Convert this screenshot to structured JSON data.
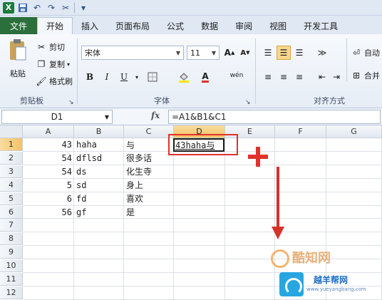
{
  "qat": {
    "icons": [
      "excel-logo",
      "save-icon",
      "undo-icon",
      "redo-icon",
      "customize-icon"
    ]
  },
  "tabs": [
    "文件",
    "开始",
    "插入",
    "页面布局",
    "公式",
    "数据",
    "审阅",
    "视图",
    "开发工具"
  ],
  "active_tab": "开始",
  "clipboard": {
    "paste": "粘贴",
    "cut": "剪切",
    "copy": "复制",
    "format_painter": "格式刷",
    "label": "剪贴板"
  },
  "font": {
    "name": "宋体",
    "size": "11",
    "label": "字体",
    "bold": "B",
    "italic": "I",
    "underline": "U",
    "font_color_glyph": "A",
    "phonetic": "wén"
  },
  "alignment": {
    "label": "对齐方式",
    "wrap": "自动",
    "merge": "合并"
  },
  "formula_bar": {
    "name_box": "D1",
    "fx": "fx",
    "formula": "=A1&B1&C1"
  },
  "columns": [
    "A",
    "B",
    "C",
    "D",
    "E",
    "F",
    "G"
  ],
  "rows": [
    "1",
    "2",
    "3",
    "4",
    "5",
    "6",
    "7",
    "8",
    "9",
    "10",
    "11",
    "12"
  ],
  "cells": {
    "A": [
      "43",
      "54",
      "54",
      "5",
      "6",
      "56"
    ],
    "B": [
      "haha",
      "dflsd",
      "ds",
      "sd",
      "fd",
      "gf"
    ],
    "C": [
      "与",
      "很多话",
      "化生寺",
      "身上",
      "喜欢",
      "是"
    ],
    "D1": "43haha与"
  },
  "selected_cell": "D1",
  "watermark": {
    "brand1": "酷知网",
    "brand2": "越羊帮网",
    "url": "www.yueyangbang.com"
  },
  "colors": {
    "file_tab": "#2a6f3c",
    "annotation_red": "#e0322b",
    "selected_header": "#f3c463"
  }
}
